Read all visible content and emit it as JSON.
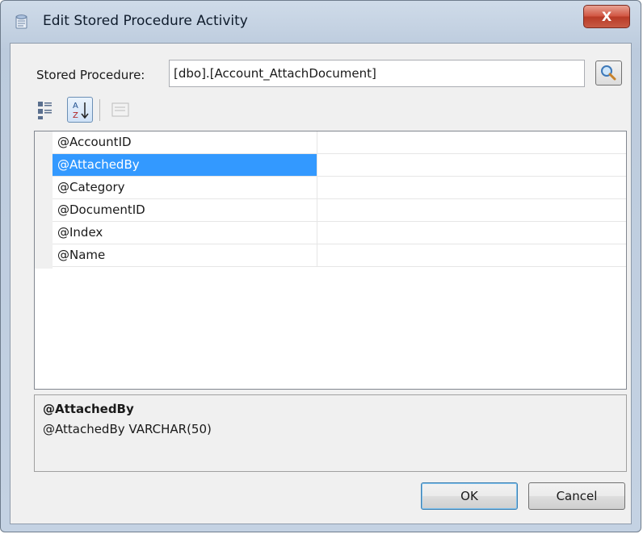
{
  "window": {
    "title": "Edit Stored Procedure Activity",
    "close_label": "X"
  },
  "stored_procedure": {
    "label": "Stored Procedure:",
    "value": "[dbo].[Account_AttachDocument]"
  },
  "toolbar": {
    "icons": [
      "categorized-icon",
      "alphabetical-sort-icon",
      "property-pages-icon"
    ]
  },
  "parameters": [
    {
      "name": "@AccountID",
      "value": ""
    },
    {
      "name": "@AttachedBy",
      "value": "",
      "selected": true
    },
    {
      "name": "@Category",
      "value": ""
    },
    {
      "name": "@DocumentID",
      "value": ""
    },
    {
      "name": "@Index",
      "value": ""
    },
    {
      "name": "@Name",
      "value": ""
    }
  ],
  "help": {
    "title": "@AttachedBy",
    "description": "@AttachedBy VARCHAR(50)"
  },
  "buttons": {
    "ok": "OK",
    "cancel": "Cancel"
  },
  "colors": {
    "selection": "#3399ff",
    "close_button": "#c75a44"
  }
}
